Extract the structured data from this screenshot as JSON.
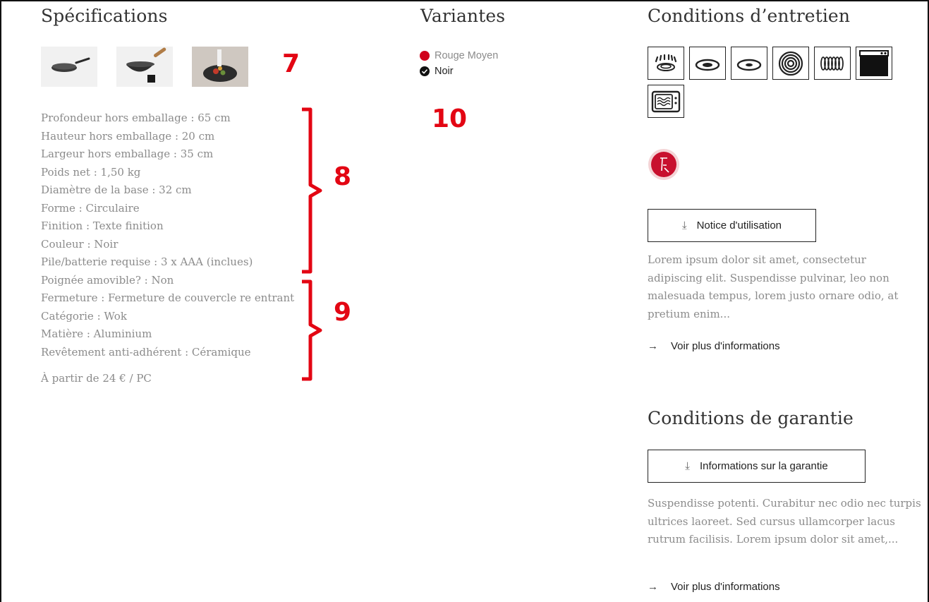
{
  "sections": {
    "specs_title": "Spécifications",
    "variants_title": "Variantes",
    "care_title": "Conditions d’entretien",
    "warranty_title": "Conditions de garantie"
  },
  "specs": [
    "Profondeur hors emballage : 65 cm",
    "Hauteur hors emballage : 20 cm",
    "Largeur hors emballage : 35 cm",
    "Poids net : 1,50 kg",
    "Diamètre de la base : 32 cm",
    "Forme : Circulaire",
    "Finition : Texte finition",
    "Couleur : Noir",
    "Pile/batterie requise : 3 x AAA (inclues)",
    "Poignée amovible? : Non",
    "Fermeture : Fermeture de couvercle re entrant",
    "Catégorie : Wok",
    "Matière : Aluminium",
    "Revêtement anti-adhérent : Céramique"
  ],
  "price": "À partir de 24 € / PC",
  "variants": [
    {
      "label": "Rouge Moyen",
      "color": "#d0021b"
    },
    {
      "label": "Noir",
      "color": "#111111"
    }
  ],
  "annotations": {
    "a7": "7",
    "a8": "8",
    "a9": "9",
    "a10": "10",
    "color": "#e30613"
  },
  "care_icons": [
    "gas-stove-icon",
    "ceramic-hob-icon",
    "electric-hob-icon",
    "induction-icon",
    "halogen-icon",
    "oven-icon",
    "microwave-icon"
  ],
  "care": {
    "manual_button": "Notice d'utilisation",
    "text": "Lorem ipsum dolor sit amet, consectetur adipiscing elit. Suspendisse pulvinar, leo non malesuada tempus, lorem justo ornare odio, at pretium enim...",
    "more_link": "Voir plus d'informations"
  },
  "warranty": {
    "button": "Informations sur la garantie",
    "text": "Suspendisse potenti. Curabitur nec odio nec turpis ultrices laoreet. Sed cursus ullamcorper lacus rutrum facilisis. Lorem ipsum dolor sit amet,...",
    "more_link": "Voir plus d'informations"
  }
}
